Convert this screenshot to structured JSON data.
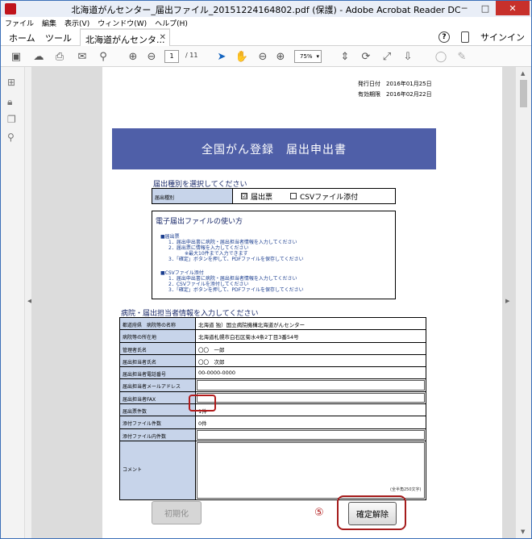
{
  "window": {
    "title": "北海道がんセンター_届出ファイル_20151224164802.pdf (保護) - Adobe Acrobat Reader DC"
  },
  "menu": [
    "ファイル",
    "編集",
    "表示(V)",
    "ウィンドウ(W)",
    "ヘルプ(H)"
  ],
  "tabs": {
    "home": "ホーム",
    "tools": "ツール",
    "document": "北海道がんセンタ...",
    "signin": "サインイン"
  },
  "toolbar": {
    "page_current": "1",
    "page_total": "/ 11",
    "zoom": "75%"
  },
  "doc": {
    "issue_date_label": "発行日付",
    "issue_date": "2016年01月25日",
    "expiry_label": "有効期限",
    "expiry_date": "2016年02月22日",
    "banner": "全国がん登録　届出申出書",
    "type_section": "届出種別を選択してください",
    "type_label": "届出種別",
    "opt1": "届出票",
    "opt1_check": "☑",
    "opt2": "CSVファイル添付",
    "usage_title": "電子届出ファイルの使い方",
    "usage_lines": [
      "■届出票",
      "1．届出申出書に病院・届出担当者情報を入力してください",
      "2．届出票に情報を入力してください",
      "※最大10件まで入力できます",
      "3．「確定」ボタンを押して、PDFファイルを保存してください",
      "■CSVファイル添付",
      "1．届出申出書に病院・届出担当者情報を入力してください",
      "2．CSVファイルを添付してください",
      "3．「確定」ボタンを押して、PDFファイルを保存してください"
    ],
    "hospital_section": "病院・届出担当者情報を入力してください",
    "rows": [
      {
        "k": "都道府県　病院等の名称",
        "v": "北海道 独）国立病院機構北海道がんセンター"
      },
      {
        "k": "病院等の所在地",
        "v": "北海道札幌市白石区菊水4条2丁目3番54号"
      },
      {
        "k": "管理者氏名",
        "v": "〇〇　一郎"
      },
      {
        "k": "届出担当者氏名",
        "v": "〇〇　次郎"
      },
      {
        "k": "届出担当者電話番号",
        "v": "00-0000-0000"
      },
      {
        "k": "届出担当者メールアドレス",
        "v": ""
      },
      {
        "k": "届出担当者FAX",
        "v": ""
      },
      {
        "k": "届出票件数",
        "v": "1件"
      },
      {
        "k": "添付ファイル件数",
        "v": "0件"
      },
      {
        "k": "添付ファイル内件数",
        "v": ""
      },
      {
        "k": "コメント",
        "v": ""
      }
    ],
    "char_limit": "(全半角250文字)",
    "btn_init": "初期化",
    "step_marker": "⑤",
    "btn_confirm": "確定解除"
  },
  "colors": {
    "banner": "#4f5fa8",
    "highlight": "#b21c1c",
    "label_bg": "#c7d4ea"
  }
}
